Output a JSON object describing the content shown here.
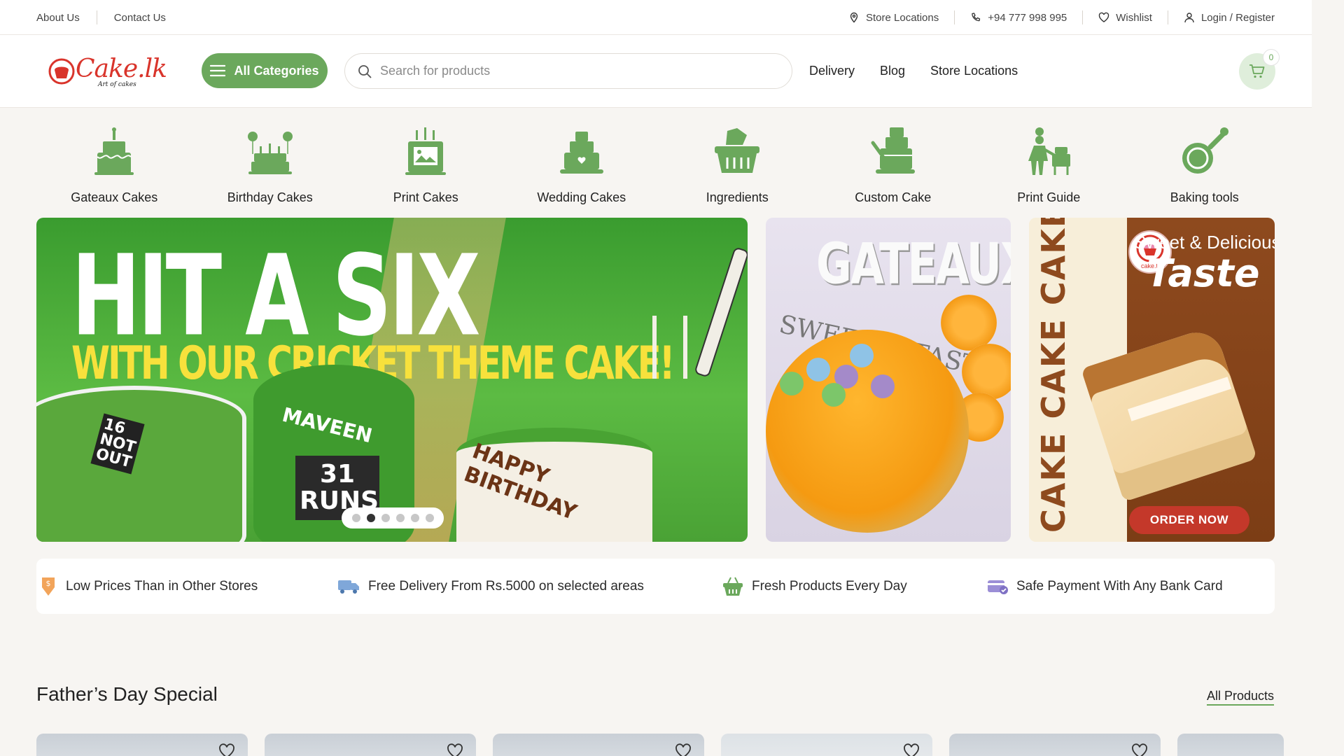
{
  "topbar": {
    "about": "About Us",
    "contact": "Contact Us",
    "store_locations": "Store Locations",
    "phone": "+94 777 998 995",
    "wishlist": "Wishlist",
    "login": "Login / Register"
  },
  "header": {
    "logo_text": "Cake.lk",
    "logo_tagline": "Art of cakes",
    "all_categories": "All Categories",
    "search_placeholder": "Search for products",
    "nav": [
      "Delivery",
      "Blog",
      "Store Locations"
    ],
    "cart_count": "0"
  },
  "categories": [
    {
      "label": "Gateaux Cakes",
      "icon": "gateaux-cake-icon"
    },
    {
      "label": "Birthday Cakes",
      "icon": "birthday-cake-icon"
    },
    {
      "label": "Print Cakes",
      "icon": "print-cake-icon"
    },
    {
      "label": "Wedding Cakes",
      "icon": "wedding-cake-icon"
    },
    {
      "label": "Ingredients",
      "icon": "ingredients-basket-icon"
    },
    {
      "label": "Custom Cake",
      "icon": "custom-cake-icon"
    },
    {
      "label": "Print Guide",
      "icon": "chef-icon"
    },
    {
      "label": "Baking tools",
      "icon": "baking-tool-icon"
    }
  ],
  "banners": {
    "main": {
      "line1": "HIT A SIX",
      "line2": "WITH OUR CRICKET THEME CAKE!",
      "cake_text_1": "16 NOT OUT",
      "cake_text_2": "31 RUNS",
      "cake_text_3": "MAVEEN",
      "cake_text_4": "HAPPY BIRTHDAY",
      "slides": 6,
      "active_slide": 2
    },
    "gateaux": {
      "title": "GATEAUX",
      "subtitle": "SWEET & TASTY"
    },
    "taste": {
      "vertical": "CAKE CAKE CAKE",
      "tagline": "Sweet & Delicious",
      "title": "Taste",
      "cta": "ORDER NOW",
      "seal_text": "cake.lk"
    }
  },
  "features": [
    {
      "label": "Low Prices Than in Other Stores",
      "icon": "price-tag-icon"
    },
    {
      "label": "Free Delivery From Rs.5000 on selected areas",
      "icon": "delivery-truck-icon"
    },
    {
      "label": "Fresh Products Every Day",
      "icon": "basket-icon"
    },
    {
      "label": "Safe Payment With Any Bank Card",
      "icon": "bank-card-icon"
    }
  ],
  "section": {
    "title": "Father’s Day Special",
    "link": "All Products"
  },
  "colors": {
    "accent_green": "#6ba85c",
    "brand_red": "#d9342b",
    "background": "#f7f5f2"
  }
}
